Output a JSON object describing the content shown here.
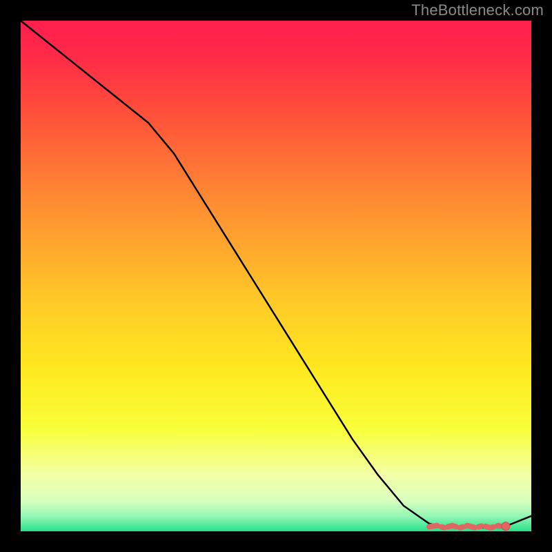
{
  "watermark": "TheBottleneck.com",
  "colors": {
    "background": "#000000",
    "line": "#000000",
    "marker_fill": "#e06666",
    "marker_stroke": "#c04f4f",
    "gradient_stops": [
      {
        "offset": 0.0,
        "color": "#ff1f4d"
      },
      {
        "offset": 0.07,
        "color": "#ff2a47"
      },
      {
        "offset": 0.18,
        "color": "#ff4f3a"
      },
      {
        "offset": 0.3,
        "color": "#ff7a35"
      },
      {
        "offset": 0.42,
        "color": "#ffa02f"
      },
      {
        "offset": 0.55,
        "color": "#ffca28"
      },
      {
        "offset": 0.68,
        "color": "#ffe81f"
      },
      {
        "offset": 0.8,
        "color": "#f9ff3a"
      },
      {
        "offset": 0.89,
        "color": "#f3ffa6"
      },
      {
        "offset": 0.94,
        "color": "#d9ffbf"
      },
      {
        "offset": 0.97,
        "color": "#96f7b5"
      },
      {
        "offset": 1.0,
        "color": "#27e08a"
      }
    ]
  },
  "chart_data": {
    "type": "line",
    "title": "",
    "xlabel": "",
    "ylabel": "",
    "xlim": [
      0,
      100
    ],
    "ylim": [
      0,
      100
    ],
    "x": [
      0,
      5,
      10,
      15,
      20,
      25,
      30,
      35,
      40,
      45,
      50,
      55,
      60,
      65,
      70,
      75,
      80,
      82,
      85,
      88,
      90,
      92,
      95,
      100
    ],
    "values": [
      100,
      96,
      92,
      88,
      84,
      80,
      74,
      66,
      58,
      50,
      42,
      34,
      26,
      18,
      11,
      5,
      1.5,
      1,
      0.8,
      0.7,
      0.7,
      0.7,
      1,
      3
    ],
    "flat_segment": {
      "x_start": 80,
      "x_end": 95,
      "y": 0.9
    },
    "end_marker": {
      "x": 95,
      "y": 1
    },
    "grid": false,
    "legend": false
  }
}
